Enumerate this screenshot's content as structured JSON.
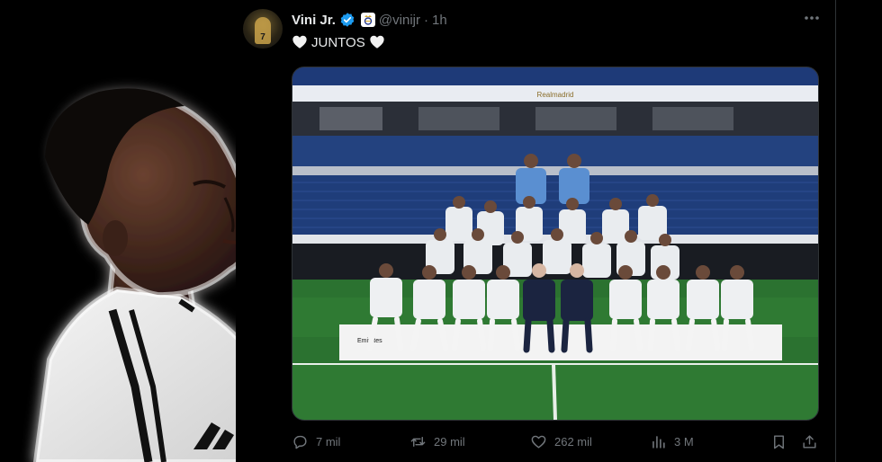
{
  "tweet": {
    "display_name": "Vini Jr.",
    "handle": "@vinijr",
    "separator": "·",
    "time": "1h",
    "text": "JUNTOS",
    "more_icon": "more-icon",
    "media": {
      "banner_text": "Realmadrid",
      "board_text": "Emirates"
    },
    "actions": {
      "replies": "7 mil",
      "reposts": "29 mil",
      "likes": "262 mil",
      "views": "3 M"
    }
  },
  "colors": {
    "background": "#000000",
    "text": "#e7e9ea",
    "muted": "#71767b",
    "verified": "#1d9bf0",
    "pitch": "#2f7a33",
    "stands": "#1e3a78"
  }
}
